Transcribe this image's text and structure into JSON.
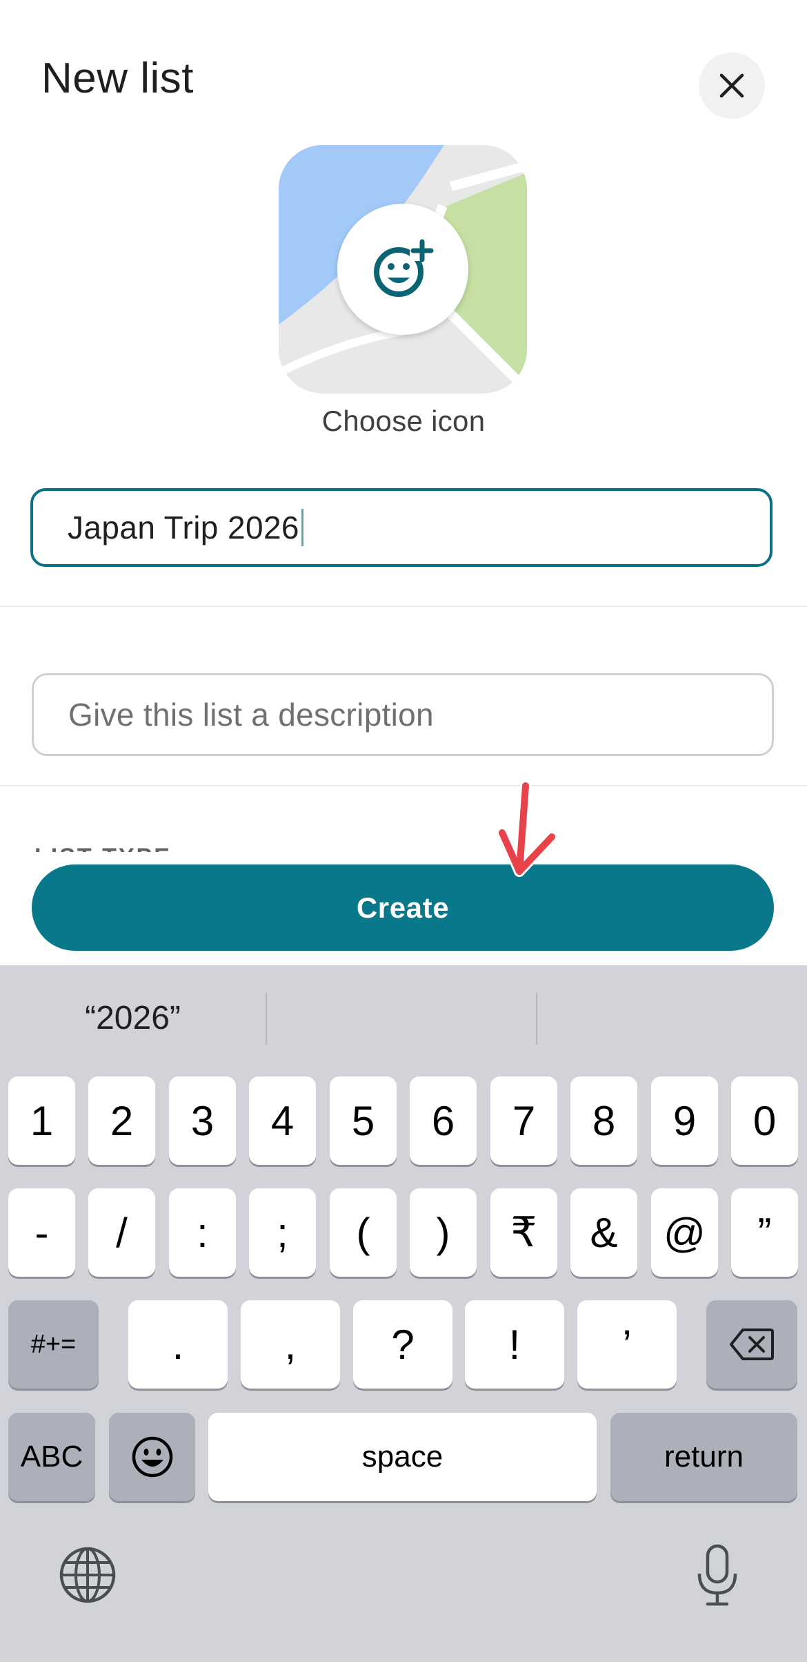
{
  "header": {
    "title": "New list"
  },
  "icon_picker": {
    "label": "Choose icon"
  },
  "name_input": {
    "value": "Japan Trip 2026"
  },
  "description_input": {
    "placeholder": "Give this list a description"
  },
  "section_peek": {
    "label": "LIST TYPE"
  },
  "create_button": {
    "label": "Create"
  },
  "colors": {
    "accent": "#08788a",
    "focus_border": "#0b7285",
    "annotation_arrow": "#e8424a",
    "keyboard_bg": "#d1d3d9"
  },
  "keyboard": {
    "suggestions": [
      "“2026”",
      "",
      ""
    ],
    "row1": [
      "1",
      "2",
      "3",
      "4",
      "5",
      "6",
      "7",
      "8",
      "9",
      "0"
    ],
    "row2": [
      "-",
      "/",
      ":",
      ";",
      "(",
      ")",
      "₹",
      "&",
      "@",
      "”"
    ],
    "row3": {
      "mode_key": "#+=",
      "keys": [
        ".",
        ",",
        "?",
        "!",
        "’"
      ]
    },
    "row4": {
      "abc": "ABC",
      "space": "space",
      "return": "return"
    }
  }
}
